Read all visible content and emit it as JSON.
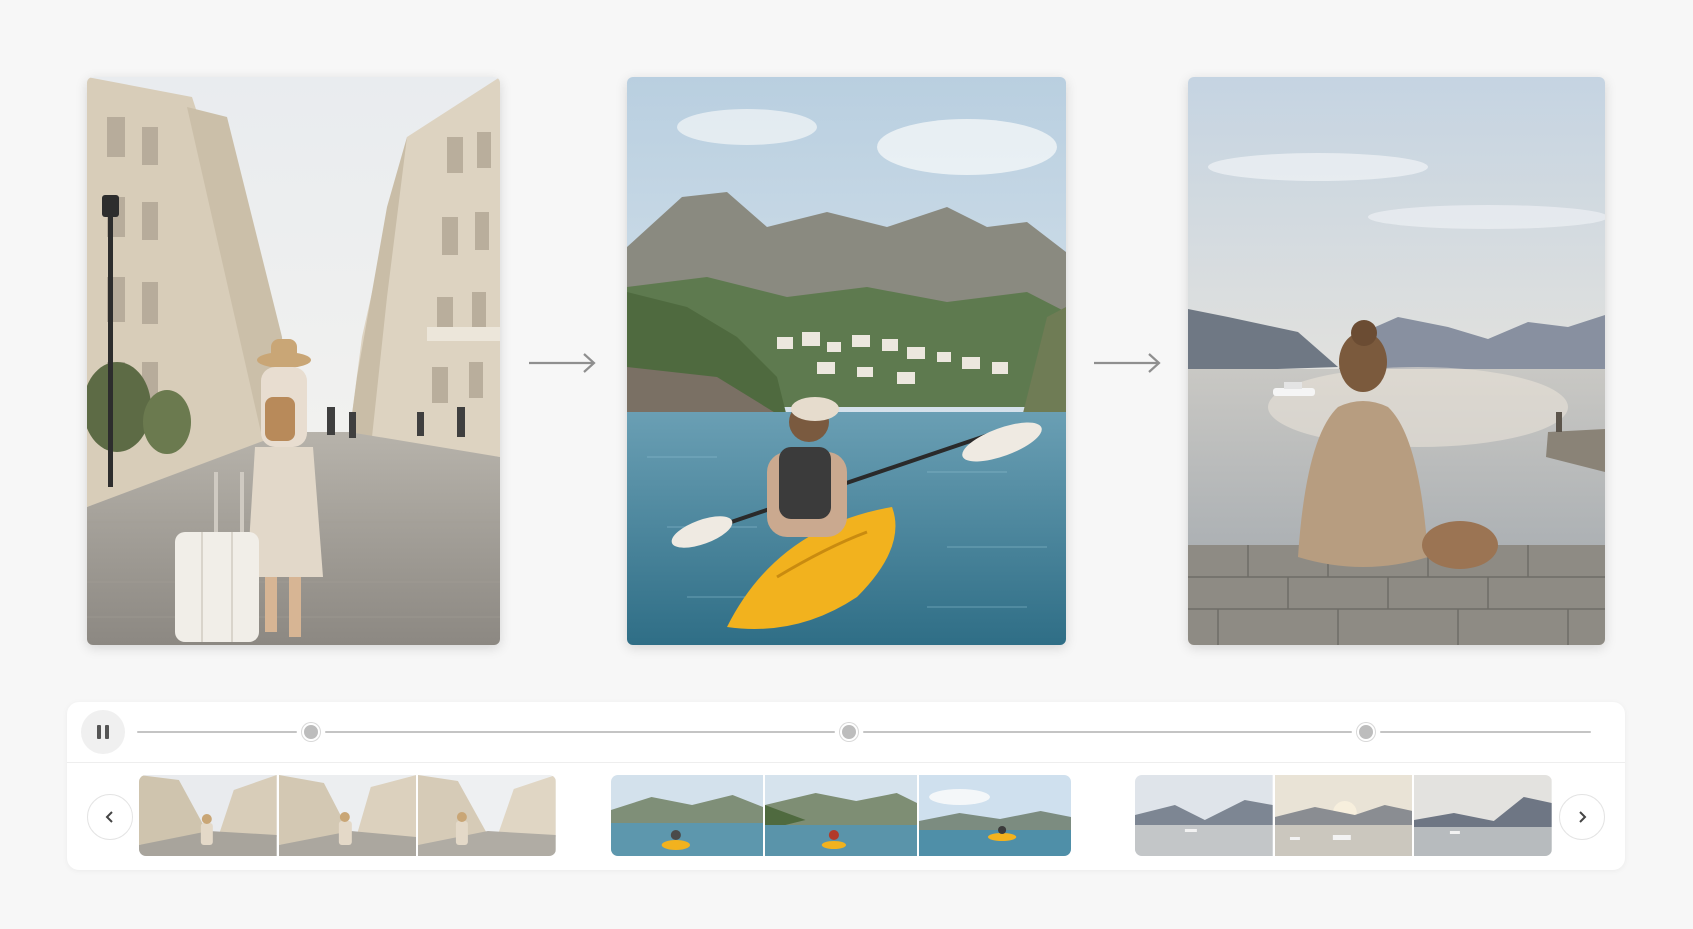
{
  "scenes": [
    {
      "name": "city-street",
      "icon": "woman-with-suitcase-walking-street"
    },
    {
      "name": "kayak-sea",
      "icon": "woman-kayaking-near-coastal-town"
    },
    {
      "name": "lake-sunset",
      "icon": "woman-sitting-on-stone-wall-at-lake"
    }
  ],
  "flow": {
    "arrow_icon": "arrow-right-icon",
    "arrow_color": "#8f8f8f"
  },
  "player": {
    "pause_icon": "pause-icon",
    "markers": [
      0.12,
      0.49,
      0.845
    ],
    "prev_icon": "chevron-left-icon",
    "next_icon": "chevron-right-icon"
  },
  "thumbnails": {
    "groups": [
      {
        "scene": "city-street",
        "count": 3
      },
      {
        "scene": "kayak-sea",
        "count": 3
      },
      {
        "scene": "lake-sunset",
        "count": 3
      }
    ]
  },
  "colors": {
    "background": "#f7f7f7",
    "panel": "#ffffff",
    "track": "#c4c4c4",
    "marker": "#bdbdbd",
    "kayak": "#f2b21e",
    "sky": "#cfe0ee",
    "sea": "#4f8fa8"
  }
}
